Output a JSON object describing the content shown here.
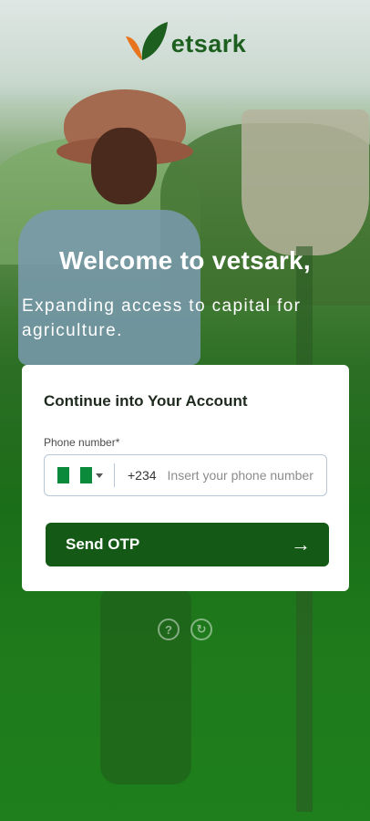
{
  "brand": {
    "name": "etsark",
    "accent": "#145a16",
    "orange": "#e8741d"
  },
  "hero": {
    "welcome": "Welcome to vetsark,",
    "tagline": "Expanding access to capital for agriculture."
  },
  "login_card": {
    "title": "Continue into Your Account",
    "phone_label": "Phone number*",
    "country_code": "+234",
    "phone_placeholder": "Insert your phone number",
    "phone_value": "",
    "flag_icon": "nigeria-flag-icon",
    "submit_label": "Send OTP",
    "submit_icon": "arrow-right-icon"
  },
  "footer_icons": [
    {
      "icon": "help-icon",
      "glyph": "?"
    },
    {
      "icon": "support-icon",
      "glyph": "↻"
    }
  ]
}
